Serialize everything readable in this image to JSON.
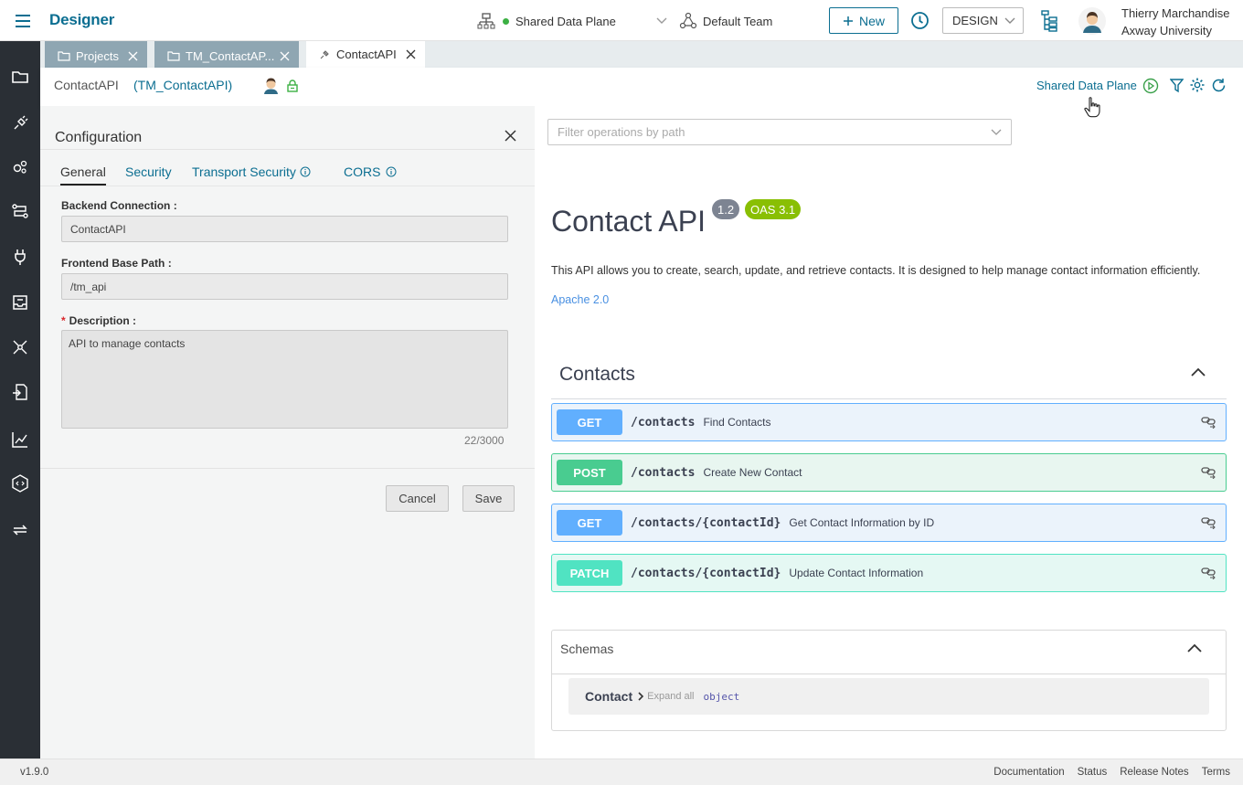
{
  "app": {
    "title": "Designer"
  },
  "header": {
    "data_plane": "Shared Data Plane",
    "team": "Default Team",
    "new_label": "New",
    "mode": "DESIGN",
    "user_name": "Thierry Marchandise",
    "user_org": "Axway University"
  },
  "tabs": [
    {
      "label": "Projects",
      "state": "inactive"
    },
    {
      "label": "TM_ContactAP...",
      "state": "inactive"
    },
    {
      "label": "ContactAPI",
      "state": "active"
    }
  ],
  "subbar": {
    "name": "ContactAPI",
    "project": "(TM_ContactAPI)",
    "data_plane": "Shared Data Plane"
  },
  "config": {
    "title": "Configuration",
    "tabs": [
      "General",
      "Security",
      "Transport Security",
      "CORS"
    ],
    "backend_label": "Backend Connection",
    "backend_value": "ContactAPI",
    "base_path_label": "Frontend Base Path",
    "base_path_value": "/tm_api",
    "required_mark": "*",
    "description_label": "Description",
    "description_value": "API to manage contacts",
    "char_count": "22/3000",
    "cancel_label": "Cancel",
    "save_label": "Save"
  },
  "spec": {
    "filter_placeholder": "Filter operations by path",
    "title": "Contact API",
    "version": "1.2",
    "oas": "OAS 3.1",
    "description": "This API allows you to create, search, update, and retrieve contacts. It is designed to help manage contact information efficiently.",
    "license": "Apache 2.0",
    "section": "Contacts",
    "operations": [
      {
        "method": "GET",
        "path": "/contacts",
        "summary": "Find Contacts"
      },
      {
        "method": "POST",
        "path": "/contacts",
        "summary": "Create New Contact"
      },
      {
        "method": "GET",
        "path": "/contacts/{contactId}",
        "summary": "Get Contact Information by ID"
      },
      {
        "method": "PATCH",
        "path": "/contacts/{contactId}",
        "summary": "Update Contact Information"
      }
    ],
    "schemas_label": "Schemas",
    "schema_name": "Contact",
    "expand_all": "Expand all",
    "schema_type": "object"
  },
  "footer": {
    "version": "v1.9.0",
    "links": [
      "Documentation",
      "Status",
      "Release Notes",
      "Terms"
    ]
  },
  "colors": {
    "accent": "#0b6e91",
    "sidebar": "#2a2f35",
    "get": "#61affe",
    "post": "#49cc90",
    "patch": "#50e3c2",
    "badge_version": "#7d8492",
    "badge_oas": "#89bf04"
  },
  "sidebar_icons": [
    "folder-icon",
    "api-plug-icon",
    "gears-icon",
    "flow-icon",
    "plug-icon",
    "inbox-icon",
    "network-icon",
    "import-icon",
    "chart-icon",
    "code-hex-icon",
    "sync-icon"
  ]
}
